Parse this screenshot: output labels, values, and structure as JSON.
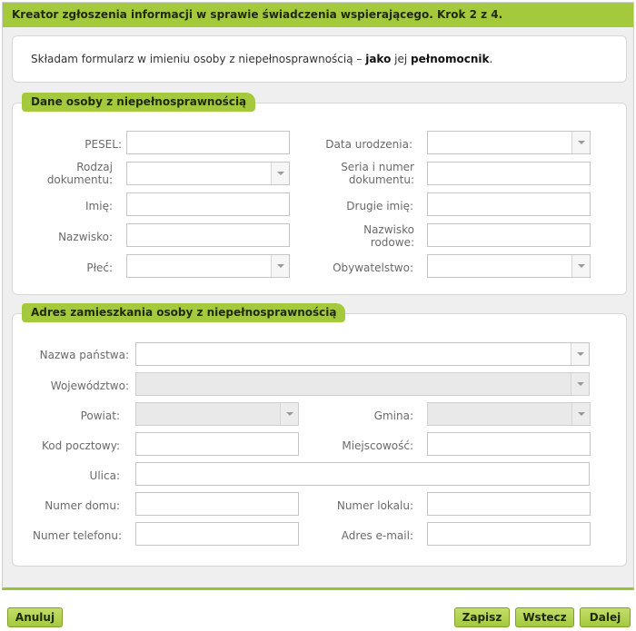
{
  "wizard": {
    "title": "Kreator zgłoszenia informacji w sprawie świadczenia wspierającego. Krok 2 z 4.",
    "intro_prefix": "Składam formularz w imieniu osoby z niepełnosprawnością – ",
    "intro_role_a": "jako",
    "intro_mid": " jej ",
    "intro_role_b": "pełnomocnik",
    "intro_suffix": "."
  },
  "person": {
    "legend": "Dane osoby z niepełnosprawnością",
    "pesel_label": "PESEL:",
    "pesel_value": "",
    "birthdate_label": "Data urodzenia:",
    "birthdate_value": "",
    "doctype_label": "Rodzaj dokumentu:",
    "doctype_value": "",
    "docnumber_label": "Seria i numer dokumentu:",
    "docnumber_value": "",
    "firstname_label": "Imię:",
    "firstname_value": "",
    "secondname_label": "Drugie imię:",
    "secondname_value": "",
    "lastname_label": "Nazwisko:",
    "lastname_value": "",
    "familyname_label": "Nazwisko rodowe:",
    "familyname_value": "",
    "sex_label": "Płeć:",
    "sex_value": "",
    "citizenship_label": "Obywatelstwo:",
    "citizenship_value": ""
  },
  "address": {
    "legend": "Adres zamieszkania osoby z niepełnosprawnością",
    "country_label": "Nazwa państwa:",
    "country_value": "",
    "voivodeship_label": "Województwo:",
    "voivodeship_value": "",
    "county_label": "Powiat:",
    "county_value": "",
    "commune_label": "Gmina:",
    "commune_value": "",
    "postal_label": "Kod pocztowy:",
    "postal_value": "",
    "city_label": "Miejscowość:",
    "city_value": "",
    "street_label": "Ulica:",
    "street_value": "",
    "house_label": "Numer domu:",
    "house_value": "",
    "flat_label": "Numer lokalu:",
    "flat_value": "",
    "phone_label": "Numer telefonu:",
    "phone_value": "",
    "email_label": "Adres e-mail:",
    "email_value": ""
  },
  "footer": {
    "cancel": "Anuluj",
    "save": "Zapisz",
    "back": "Wstecz",
    "next": "Dalej"
  },
  "colors": {
    "accent": "#a4c93c",
    "panel": "#efefef"
  }
}
